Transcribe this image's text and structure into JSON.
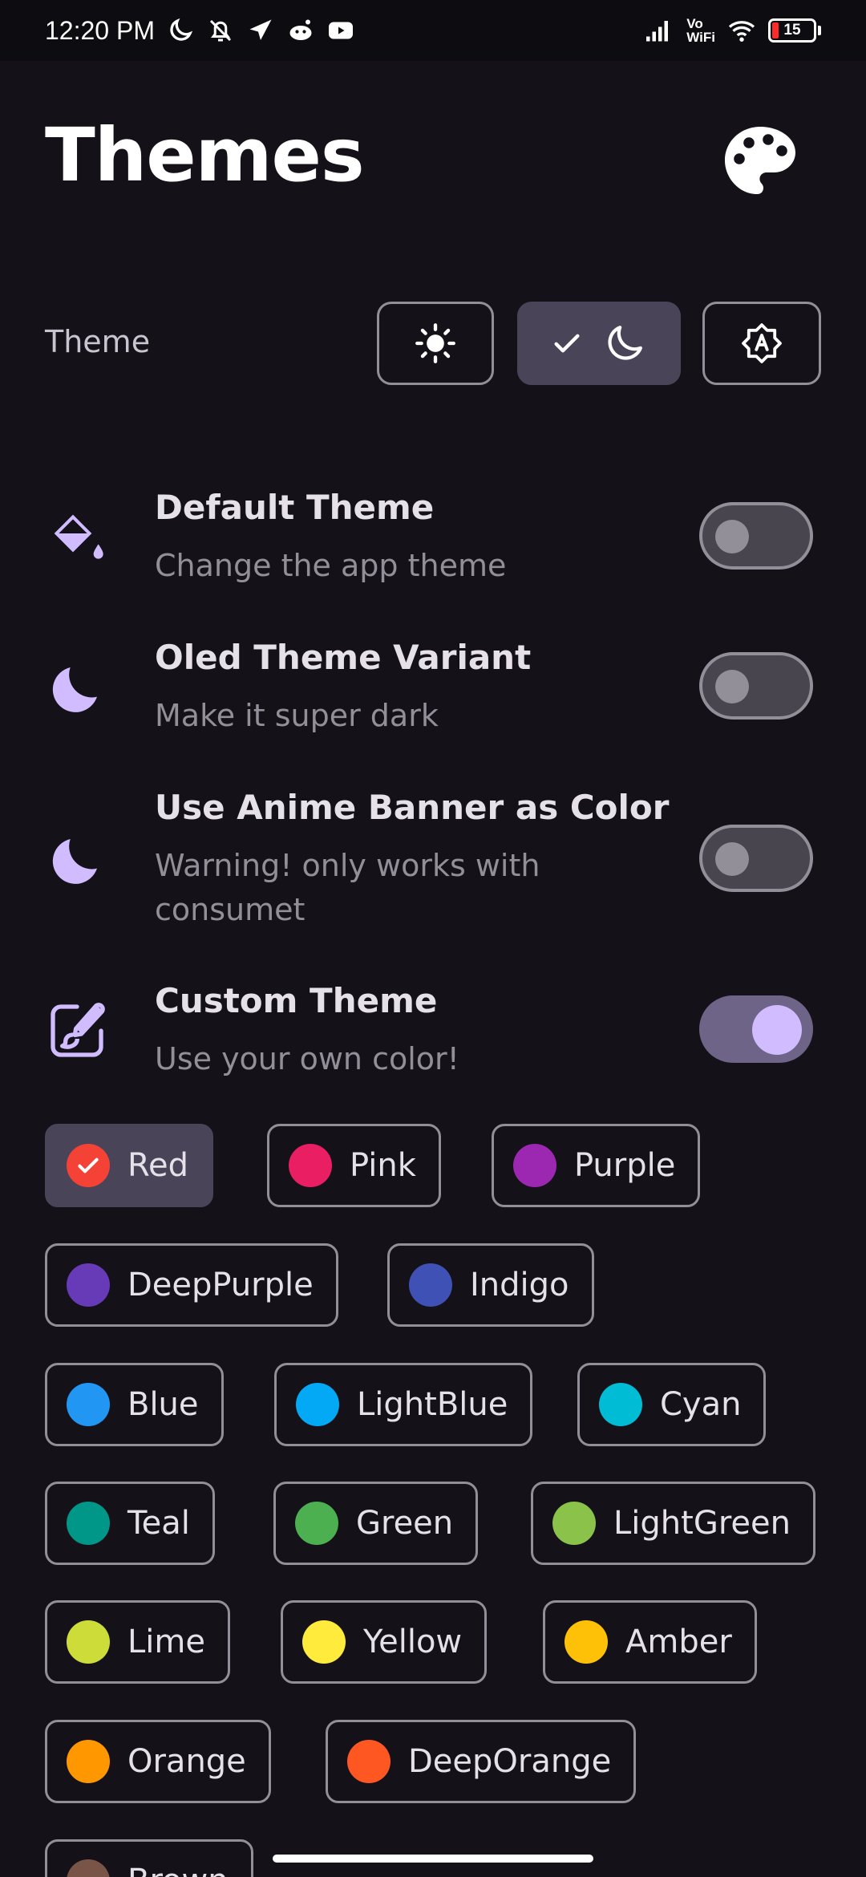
{
  "status_bar": {
    "time": "12:20 PM",
    "vo": "Vo",
    "wifi_label": "WiFi",
    "battery": "15",
    "icons": [
      "moon-icon",
      "bell-off-icon",
      "navigation-icon",
      "reddit-icon",
      "youtube-icon",
      "signal-icon",
      "wifi-icon",
      "battery-icon"
    ]
  },
  "header": {
    "title": "Themes",
    "icon": "palette-icon"
  },
  "theme_selector": {
    "label": "Theme",
    "options": [
      {
        "icon": "sun-icon",
        "selected": false
      },
      {
        "icon": "moon-icon",
        "selected": true
      },
      {
        "icon": "auto-brightness-icon",
        "selected": false
      }
    ]
  },
  "settings": [
    {
      "title": "Default Theme",
      "subtitle": "Change the app theme",
      "icon": "paint-bucket-icon",
      "enabled": false
    },
    {
      "title": "Oled Theme Variant",
      "subtitle": "Make it super dark",
      "icon": "moon-icon",
      "enabled": false
    },
    {
      "title": "Use Anime Banner as Color",
      "subtitle": "Warning! only works with consumet",
      "icon": "moon-icon",
      "enabled": false
    },
    {
      "title": "Custom Theme",
      "subtitle": "Use your own color!",
      "icon": "brush-edit-icon",
      "enabled": true
    }
  ],
  "colors": [
    {
      "label": "Red",
      "color": "#F44336",
      "selected": true
    },
    {
      "label": "Pink",
      "color": "#E91E63",
      "selected": false
    },
    {
      "label": "Purple",
      "color": "#9C27B0",
      "selected": false
    },
    {
      "label": "DeepPurple",
      "color": "#673AB7",
      "selected": false
    },
    {
      "label": "Indigo",
      "color": "#3F51B5",
      "selected": false
    },
    {
      "label": "Blue",
      "color": "#2196F3",
      "selected": false
    },
    {
      "label": "LightBlue",
      "color": "#03A9F4",
      "selected": false
    },
    {
      "label": "Cyan",
      "color": "#00BCD4",
      "selected": false
    },
    {
      "label": "Teal",
      "color": "#009688",
      "selected": false
    },
    {
      "label": "Green",
      "color": "#4CAF50",
      "selected": false
    },
    {
      "label": "LightGreen",
      "color": "#8BC34A",
      "selected": false
    },
    {
      "label": "Lime",
      "color": "#CDDC39",
      "selected": false
    },
    {
      "label": "Yellow",
      "color": "#FFEB3B",
      "selected": false
    },
    {
      "label": "Amber",
      "color": "#FFC107",
      "selected": false
    },
    {
      "label": "Orange",
      "color": "#FF9800",
      "selected": false
    },
    {
      "label": "DeepOrange",
      "color": "#FF5722",
      "selected": false
    },
    {
      "label": "Brown",
      "color": "#795548",
      "selected": false
    }
  ],
  "accent_color": "#D0BCFF",
  "background_color": "#141218"
}
